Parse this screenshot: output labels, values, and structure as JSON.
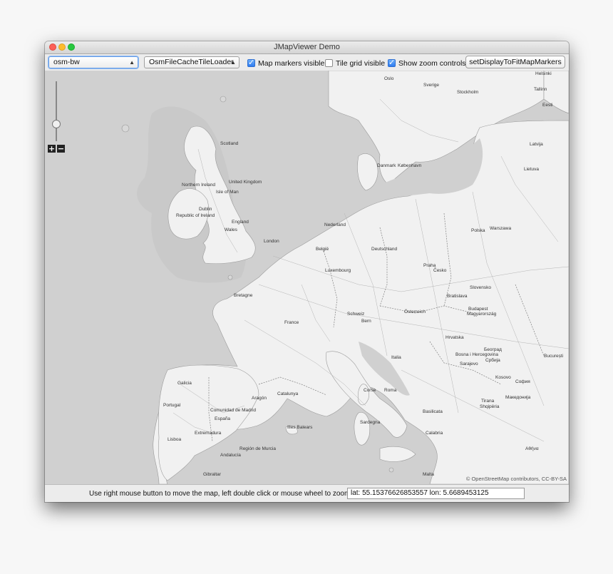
{
  "window": {
    "title": "JMapViewer Demo"
  },
  "toolbar": {
    "tile_source": "osm-bw",
    "tile_loader": "OsmFileCacheTileLoader",
    "markers_label": "Map markers visible",
    "markers_checked": true,
    "grid_label": "Tile grid visible",
    "grid_checked": false,
    "zoom_controls_label": "Show zoom controls",
    "zoom_controls_checked": true,
    "fit_button": "setDisplayToFitMapMarkers"
  },
  "map": {
    "attribution": "© OpenStreetMap contributors, CC-BY-SA",
    "zoom_in": "+",
    "zoom_out": "−",
    "labels": {
      "scotland": "Scotland",
      "uk": "United Kingdom",
      "isle_of_man": "Isle of Man",
      "northern_ireland": "Northern Ireland",
      "ireland": "Republic of Ireland",
      "dublin": "Dublin",
      "wales": "Wales",
      "england": "England",
      "london": "London",
      "oslo": "Oslo",
      "sverige": "Sverige",
      "stockholm": "Stockholm",
      "helsinki": "Helsinki",
      "tallinn": "Tallinn",
      "eesti": "Eesti",
      "latvija": "Latvija",
      "lietuva": "Lietuva",
      "danmark": "Danmark",
      "kobenhavn": "København",
      "nederland": "Nederland",
      "belgie": "België",
      "luxembourg": "Luxembourg",
      "deutschland": "Deutschland",
      "polska": "Polska",
      "warszawa": "Warszawa",
      "praha": "Praha",
      "cesko": "Česko",
      "slovensko": "Slovensko",
      "bratislava": "Bratislava",
      "osterreich": "Österreich",
      "budapest": "Budapest",
      "magyarorszag": "Magyarország",
      "bern": "Bern",
      "schweiz": "Schweiz",
      "france": "France",
      "bretagne": "Bretagne",
      "hrvatska": "Hrvatska",
      "bosna": "Bosna i Hercegovina",
      "srbija": "Србија",
      "beograd": "Београд",
      "sarajevo": "Sarajevo",
      "bucuresti": "București",
      "sofia": "София",
      "kosovo": "Kosovo",
      "tirana": "Tirana",
      "shqiperia": "Shqipëria",
      "makedonija": "Македонија",
      "italia": "Italia",
      "roma": "Roma",
      "sardegna": "Sardegna",
      "corse": "Corse",
      "espana": "España",
      "madrid": "Comunidad de Madrid",
      "galicia": "Galicia",
      "aragon": "Aragón",
      "catalunya": "Catalunya",
      "extremadura": "Extremadura",
      "andalucia": "Andalucía",
      "portugal": "Portugal",
      "lisboa": "Lisboa",
      "illes_balears": "Illes Balears",
      "murcia": "Región de Murcia",
      "basilicata": "Basilicata",
      "calabria": "Calabria",
      "gibraltar": "Gibraltar",
      "malta": "Malta",
      "athina": "Αθήνα"
    }
  },
  "status": {
    "help": "Use right mouse button to move the map,  left double click or mouse wheel to zoom.",
    "coords": "lat: 55.15376626853557   lon: 5.6689453125"
  }
}
